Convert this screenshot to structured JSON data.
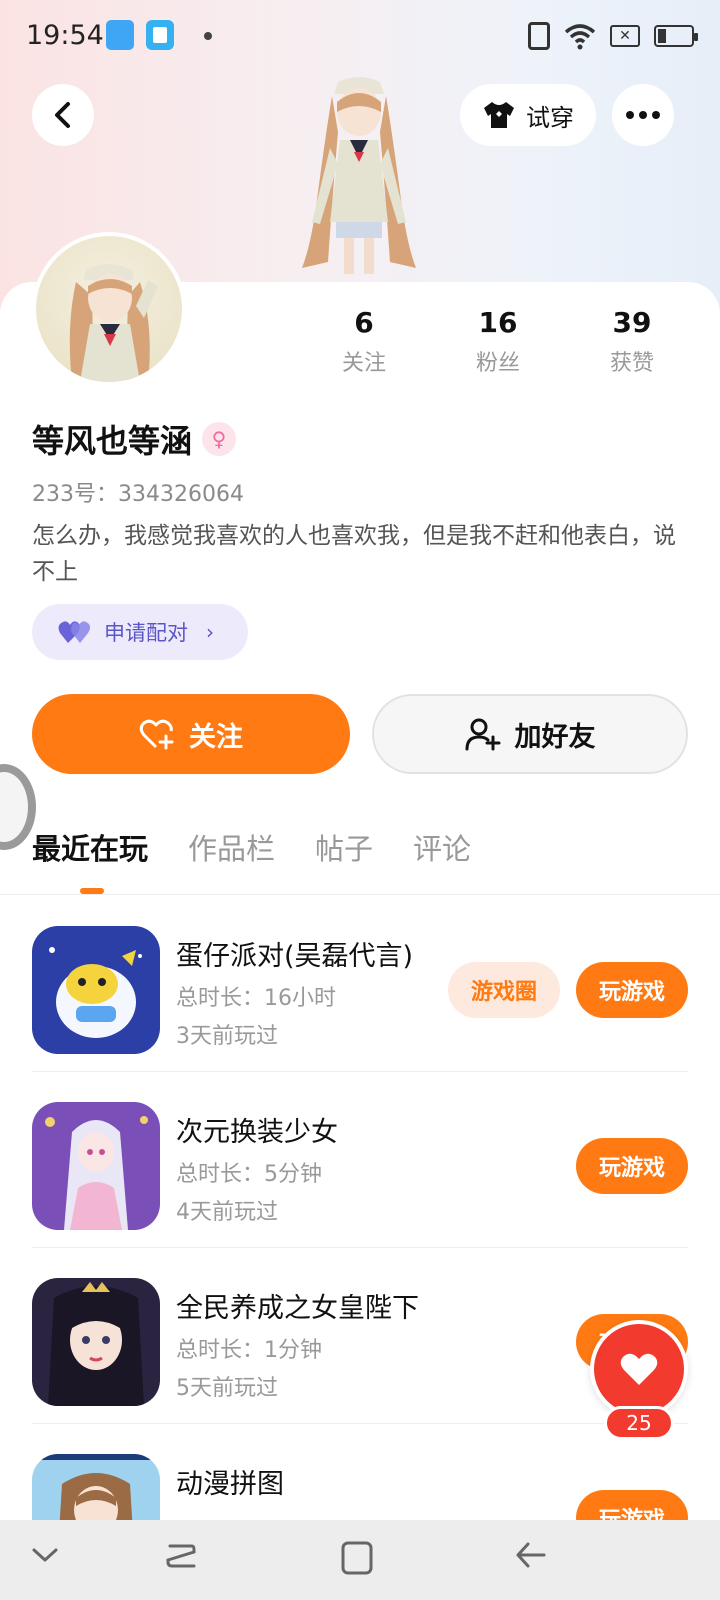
{
  "status_bar": {
    "time": "19:54",
    "sim_icon": "✕"
  },
  "header": {
    "tryon_label": "试穿"
  },
  "profile": {
    "name": "等风也等涵",
    "uid": "233号：334326064",
    "bio": "怎么办，我感觉我喜欢的人也喜欢我，但是我不赶和他表白，说不上",
    "pair_label": "申请配对",
    "stats": [
      {
        "value": "6",
        "label": "关注"
      },
      {
        "value": "16",
        "label": "粉丝"
      },
      {
        "value": "39",
        "label": "获赞"
      }
    ]
  },
  "actions": {
    "follow_label": "关注",
    "add_friend_label": "加好友"
  },
  "tabs": [
    {
      "label": "最近在玩",
      "active": true
    },
    {
      "label": "作品栏",
      "active": false
    },
    {
      "label": "帖子",
      "active": false
    },
    {
      "label": "评论",
      "active": false
    }
  ],
  "games": [
    {
      "title": "蛋仔派对(吴磊代言)",
      "duration": "总时长：16小时",
      "last_played": "3天前玩过",
      "circle_label": "游戏圈",
      "play_label": "玩游戏"
    },
    {
      "title": "次元换装少女",
      "duration": "总时长：5分钟",
      "last_played": "4天前玩过",
      "play_label": "玩游戏"
    },
    {
      "title": "全民养成之女皇陛下",
      "duration": "总时长：1分钟",
      "last_played": "5天前玩过",
      "play_label": "玩游戏"
    },
    {
      "title": "动漫拼图",
      "play_label": "玩游戏"
    }
  ],
  "like_fab": {
    "count": "25"
  },
  "colors": {
    "accent": "#ff7a12",
    "like_red": "#f23a2f",
    "pair_purple": "#5b55c9"
  }
}
